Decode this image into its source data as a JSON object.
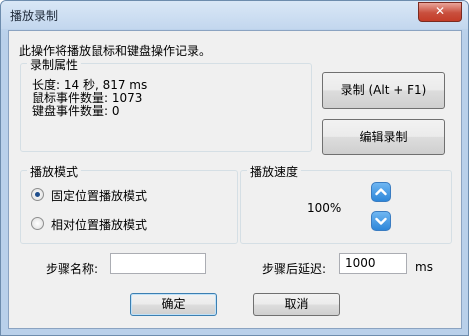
{
  "window": {
    "title": "播放录制",
    "close_label": "✕"
  },
  "intro": "此操作将播放鼠标和键盘操作记录。",
  "recording_props": {
    "label": "录制属性",
    "duration": "长度: 14 秒, 817 ms",
    "mouse_events": "鼠标事件数量: 1073",
    "keyboard_events": "键盘事件数量: 0"
  },
  "buttons": {
    "record": "录制 (Alt + F1)",
    "edit": "编辑录制",
    "ok": "确定",
    "cancel": "取消"
  },
  "playback_mode": {
    "label": "播放模式",
    "options": [
      {
        "label": "固定位置播放模式",
        "selected": true
      },
      {
        "label": "相对位置播放模式",
        "selected": false
      }
    ]
  },
  "playback_speed": {
    "label": "播放速度",
    "value": "100%"
  },
  "step_name": {
    "label": "步骤名称:",
    "value": ""
  },
  "step_delay": {
    "label": "步骤后延迟:",
    "value": "1000",
    "unit": "ms"
  },
  "colors": {
    "titlebar": "#c3d7ee",
    "client": "#f0f0f0",
    "close": "#c94f3d",
    "spin_button": "#2d86d9"
  }
}
